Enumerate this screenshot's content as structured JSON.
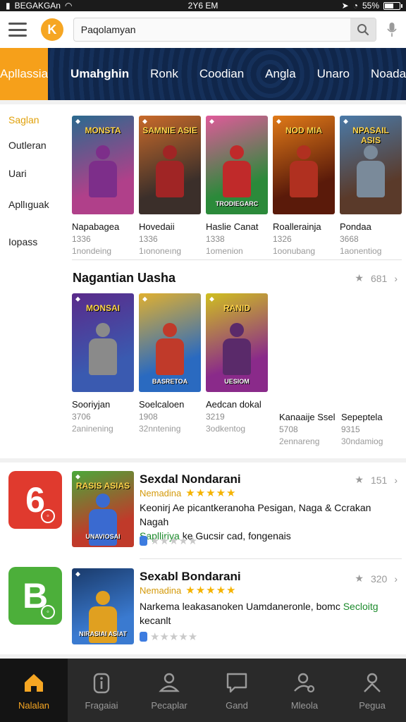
{
  "status_bar": {
    "carrier": "BEGAKGAn",
    "time": "2Y6 EM",
    "battery": "55%"
  },
  "search": {
    "value": "Paqolamyan"
  },
  "logo_letter": "K",
  "categories": {
    "active": "Apllassia",
    "tabs": [
      "Umahghin",
      "Ronk",
      "Coodian",
      "Angla",
      "Unaro"
    ],
    "right": "Noada"
  },
  "sidebar": [
    "Saglan",
    "Outleran",
    "Uari",
    "Apllıguak",
    "Iopass"
  ],
  "row1": [
    {
      "name": "Napabagea",
      "count": "1336",
      "sub": "1nondeing",
      "title": "MONSTA",
      "bottom": "",
      "palette": [
        "#2a6a8e",
        "#b0408a",
        "#7d2e8a"
      ]
    },
    {
      "name": "Hovedaii",
      "count": "1336",
      "sub": "1ıononeıng",
      "title": "SAMNIE ASIE",
      "bottom": "",
      "palette": [
        "#c86a2a",
        "#3b2f2a",
        "#a02525"
      ]
    },
    {
      "name": "Haslie Canat",
      "count": "1338",
      "sub": "1omenion",
      "title": "",
      "bottom": "TRODIEGARC",
      "palette": [
        "#e05a9a",
        "#2b8a3a",
        "#c02a2a"
      ]
    },
    {
      "name": "Roallerainja",
      "count": "1326",
      "sub": "1oonubang",
      "title": "NOD MIA",
      "bottom": "",
      "palette": [
        "#e07a18",
        "#5a1a0a",
        "#b03020"
      ]
    },
    {
      "name": "Pondaa",
      "count": "3668",
      "sub": "1aonentiog",
      "title": "NPASAIL ASIS",
      "bottom": "",
      "palette": [
        "#4a7aa8",
        "#5a3a2a",
        "#7a8a9a"
      ]
    }
  ],
  "section": {
    "title": "Nagantian Uasha",
    "count": "681"
  },
  "row2": [
    {
      "name": "Sooriyjan",
      "count": "3706",
      "sub": "2aninening",
      "title": "MONSAI",
      "bottom": "",
      "palette": [
        "#5a2a8a",
        "#3a5ab0",
        "#8a8a8a"
      ]
    },
    {
      "name": "Soelcaloen",
      "count": "1908",
      "sub": "32nntening",
      "title": "",
      "bottom": "BASRETOA",
      "palette": [
        "#e0b030",
        "#2a6ac0",
        "#c03a2a"
      ]
    },
    {
      "name": "Aedcan dokal",
      "count": "3219",
      "sub": "3odkentog",
      "title": "RANID",
      "bottom": "UESIOM",
      "palette": [
        "#d0c020",
        "#8a2a8a",
        "#5a2a6a"
      ]
    }
  ],
  "row2_text": [
    {
      "name": "Kanaaije Ssel",
      "count": "5708",
      "sub": "2ennareng"
    },
    {
      "name": "Sepeptela",
      "count": "9315",
      "sub": "30ndamiog"
    }
  ],
  "apps": [
    {
      "icon_text": "6",
      "icon_color": "#e03a2e",
      "title": "Sexdal Nondarani",
      "dev": "Nemadina",
      "rating": "151",
      "desc": "Keonirj Ae picantkeranoha Pesigan, Naga & Ccrakan Nagah",
      "desc_green": "Saplliriya",
      "desc_tail": "ke Gucsir cad, fongenais",
      "thumb_title": "RASIS ASIAS",
      "thumb_bottom": "UNAVIOSAI",
      "palette": [
        "#4aa83a",
        "#c03a2a",
        "#3a6ad0"
      ]
    },
    {
      "icon_text": "B",
      "icon_color": "#4caf3a",
      "title": "Sexabl Bondarani",
      "dev": "Nemadina",
      "rating": "320",
      "desc": "Narkema leakasanoken Uamdaneronle, bomc",
      "desc_green": "Secloitg",
      "desc_tail": "kecanlt",
      "thumb_title": "",
      "thumb_bottom": "NIRASIAI ASIAT",
      "palette": [
        "#1a3a6a",
        "#3a7ad0",
        "#e0a020"
      ]
    }
  ],
  "bottom_nav": [
    {
      "label": "Nalalan",
      "icon": "home-icon",
      "active": true
    },
    {
      "label": "Fragaiai",
      "icon": "info-icon",
      "active": false
    },
    {
      "label": "Pecaplar",
      "icon": "user-icon",
      "active": false
    },
    {
      "label": "Gand",
      "icon": "message-icon",
      "active": false
    },
    {
      "label": "Mleola",
      "icon": "user-settings-icon",
      "active": false
    },
    {
      "label": "Pegua",
      "icon": "person-icon",
      "active": false
    }
  ],
  "colors": {
    "accent": "#f6a623",
    "header": "#12274a",
    "nav": "#2a2a2a"
  }
}
